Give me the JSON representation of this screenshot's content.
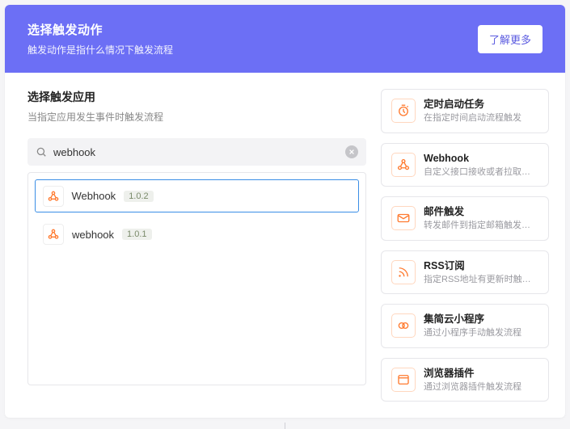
{
  "header": {
    "title": "选择触发动作",
    "subtitle": "触发动作是指什么情况下触发流程",
    "learn_more": "了解更多"
  },
  "select_app": {
    "title": "选择触发应用",
    "subtitle": "当指定应用发生事件时触发流程"
  },
  "search": {
    "value": "webhook"
  },
  "results": [
    {
      "name": "Webhook",
      "version": "1.0.2",
      "selected": true
    },
    {
      "name": "webhook",
      "version": "1.0.1",
      "selected": false
    }
  ],
  "triggers": [
    {
      "icon": "clock-icon",
      "title": "定时启动任务",
      "desc": "在指定时间启动流程触发"
    },
    {
      "icon": "webhook-icon",
      "title": "Webhook",
      "desc": "自定义接口接收或者拉取数据触发"
    },
    {
      "icon": "mail-icon",
      "title": "邮件触发",
      "desc": "转发邮件到指定邮箱触发流程"
    },
    {
      "icon": "rss-icon",
      "title": "RSS订阅",
      "desc": "指定RSS地址有更新时触发流程"
    },
    {
      "icon": "miniapp-icon",
      "title": "集简云小程序",
      "desc": "通过小程序手动触发流程"
    },
    {
      "icon": "browser-icon",
      "title": "浏览器插件",
      "desc": "通过浏览器插件触发流程"
    }
  ],
  "colors": {
    "accent": "#6c6ff5",
    "icon_orange": "#ff7a2f"
  }
}
